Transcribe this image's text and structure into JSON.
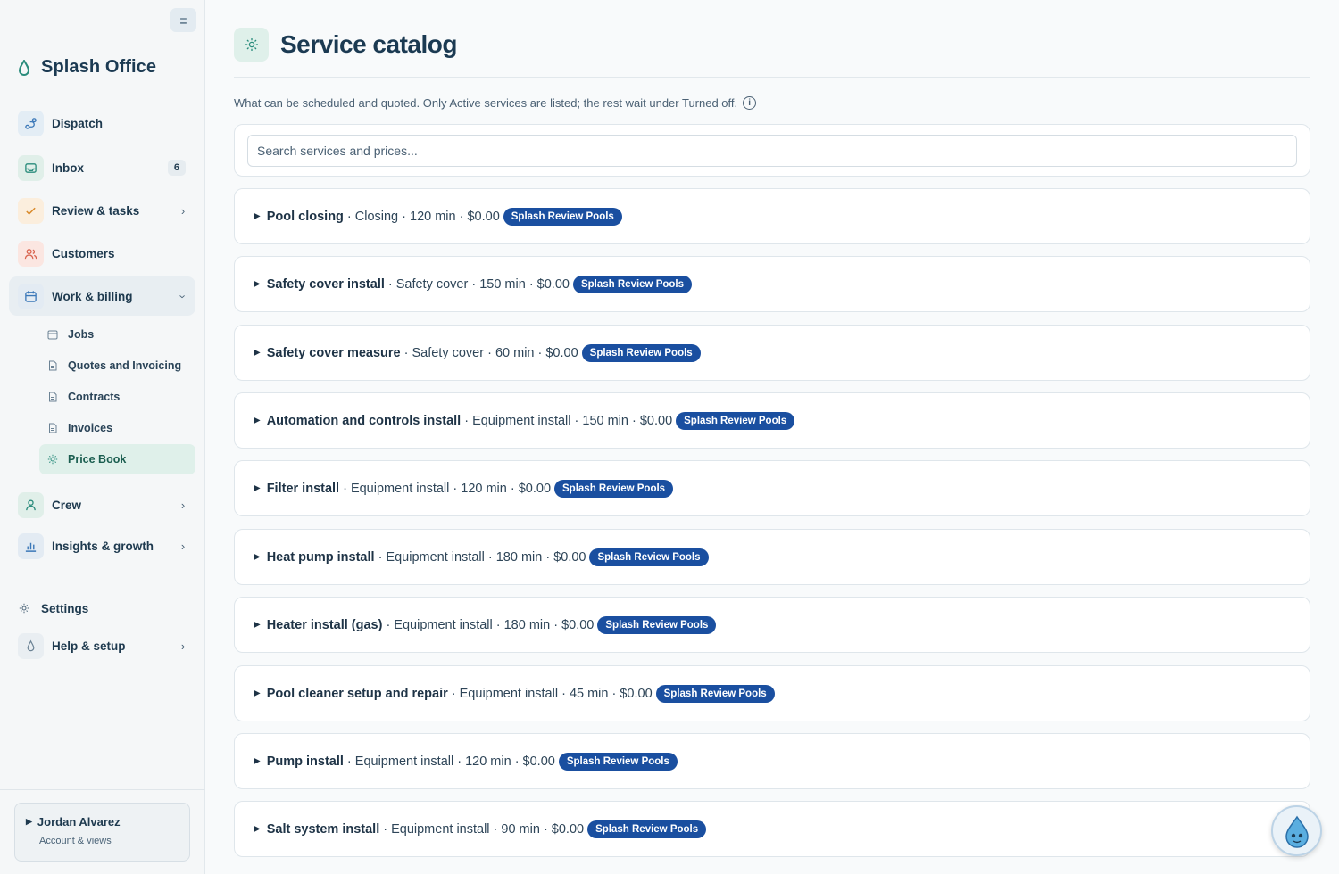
{
  "app": {
    "name": "Splash Office"
  },
  "colors": {
    "accent": "#1a4fa0",
    "brand_teal": "#2a8c7c",
    "active_bg": "#dff0ea"
  },
  "sidebar": {
    "collapse_icon": "≡",
    "items": [
      {
        "label": "Dispatch",
        "icon": "route-icon"
      },
      {
        "label": "Inbox",
        "icon": "inbox-icon",
        "badge": "6"
      },
      {
        "label": "Review & tasks",
        "icon": "check-icon",
        "chevron": "›"
      },
      {
        "label": "Customers",
        "icon": "users-icon"
      },
      {
        "label": "Work & billing",
        "icon": "calendar-icon",
        "chevron": "›"
      },
      {
        "label": "Crew",
        "icon": "person-icon",
        "chevron": "›"
      },
      {
        "label": "Insights & growth",
        "icon": "bar-chart-icon",
        "chevron": "›"
      },
      {
        "label": "Settings",
        "icon": "gear-icon"
      },
      {
        "label": "Help & setup",
        "icon": "droplet-icon",
        "chevron": "›"
      }
    ],
    "sub_items": [
      {
        "label": "Jobs",
        "icon": "calendar-icon"
      },
      {
        "label": "Quotes and Invoicing",
        "icon": "document-icon"
      },
      {
        "label": "Contracts",
        "icon": "document-icon"
      },
      {
        "label": "Invoices",
        "icon": "document-icon"
      },
      {
        "label": "Price Book",
        "icon": "gear-icon",
        "active": true
      }
    ],
    "account": {
      "name": "Jordan Alvarez",
      "subtitle": "Account & views",
      "caret": "▶"
    }
  },
  "page": {
    "title": "Service catalog",
    "intro": "What can be scheduled and quoted. Only Active services are listed; the rest wait under Turned off.",
    "info_glyph": "i",
    "search_placeholder": "Search services and prices..."
  },
  "services": [
    {
      "name": "Pool closing",
      "meta": "· Closing · 120 min · $0.00",
      "badge": "Splash Review Pools"
    },
    {
      "name": "Safety cover install",
      "meta": "· Safety cover · 150 min · $0.00",
      "badge": "Splash Review Pools"
    },
    {
      "name": "Safety cover measure",
      "meta": "· Safety cover · 60 min · $0.00",
      "badge": "Splash Review Pools"
    },
    {
      "name": "Automation and controls install",
      "meta": "· Equipment install · 150 min · $0.00",
      "badge": "Splash Review Pools"
    },
    {
      "name": "Filter install",
      "meta": "· Equipment install · 120 min · $0.00",
      "badge": "Splash Review Pools"
    },
    {
      "name": "Heat pump install",
      "meta": "· Equipment install · 180 min · $0.00",
      "badge": "Splash Review Pools"
    },
    {
      "name": "Heater install (gas)",
      "meta": "· Equipment install · 180 min · $0.00",
      "badge": "Splash Review Pools"
    },
    {
      "name": "Pool cleaner setup and repair",
      "meta": "· Equipment install · 45 min · $0.00",
      "badge": "Splash Review Pools"
    },
    {
      "name": "Pump install",
      "meta": "· Equipment install · 120 min · $0.00",
      "badge": "Splash Review Pools"
    },
    {
      "name": "Salt system install",
      "meta": "· Equipment install · 90 min · $0.00",
      "badge": "Splash Review Pools"
    }
  ],
  "row_caret": "▶"
}
